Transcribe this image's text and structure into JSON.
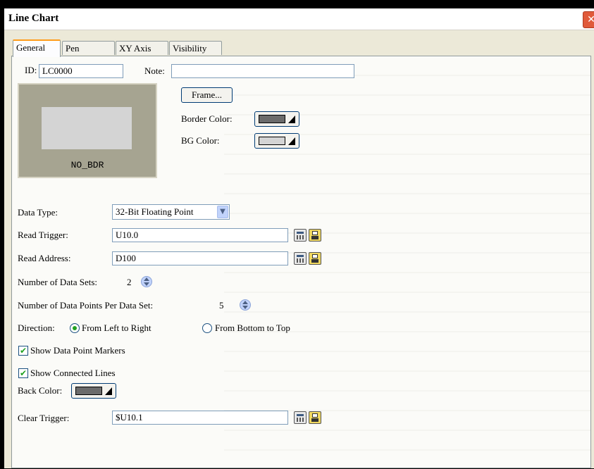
{
  "window": {
    "title": "Line Chart",
    "close_glyph": "✕"
  },
  "tabs": [
    {
      "label": "General",
      "active": true
    },
    {
      "label": "Pen",
      "active": false
    },
    {
      "label": "XY Axis",
      "active": false
    },
    {
      "label": "Visibility",
      "active": false
    }
  ],
  "general": {
    "id_label": "ID:",
    "id_value": "LC0000",
    "note_label": "Note:",
    "note_value": "",
    "preview_caption": "NO_BDR",
    "frame_button": "Frame...",
    "border_color_label": "Border Color:",
    "border_color": "#6b6b6b",
    "bg_color_label": "BG Color:",
    "bg_color": "#d4d4d4",
    "data_type_label": "Data Type:",
    "data_type_value": "32-Bit Floating Point",
    "read_trigger_label": "Read Trigger:",
    "read_trigger_value": "U10.0",
    "read_address_label": "Read Address:",
    "read_address_value": "D100",
    "num_data_sets_label": "Number of Data Sets:",
    "num_data_sets_value": "2",
    "points_per_set_label": "Number of Data Points Per Data Set:",
    "points_per_set_value": "5",
    "direction_label": "Direction:",
    "direction_option1": "From Left to Right",
    "direction_option2": "From Bottom to Top",
    "direction_selected": "From Left to Right",
    "show_markers_label": "Show Data Point Markers",
    "show_markers_checked": true,
    "show_lines_label": "Show Connected Lines",
    "show_lines_checked": true,
    "back_color_label": "Back Color:",
    "back_color": "#6b6b6b",
    "clear_trigger_label": "Clear Trigger:",
    "clear_trigger_value": "$U10.1",
    "check_glyph": "✔",
    "dropdown_glyph": "▼"
  }
}
